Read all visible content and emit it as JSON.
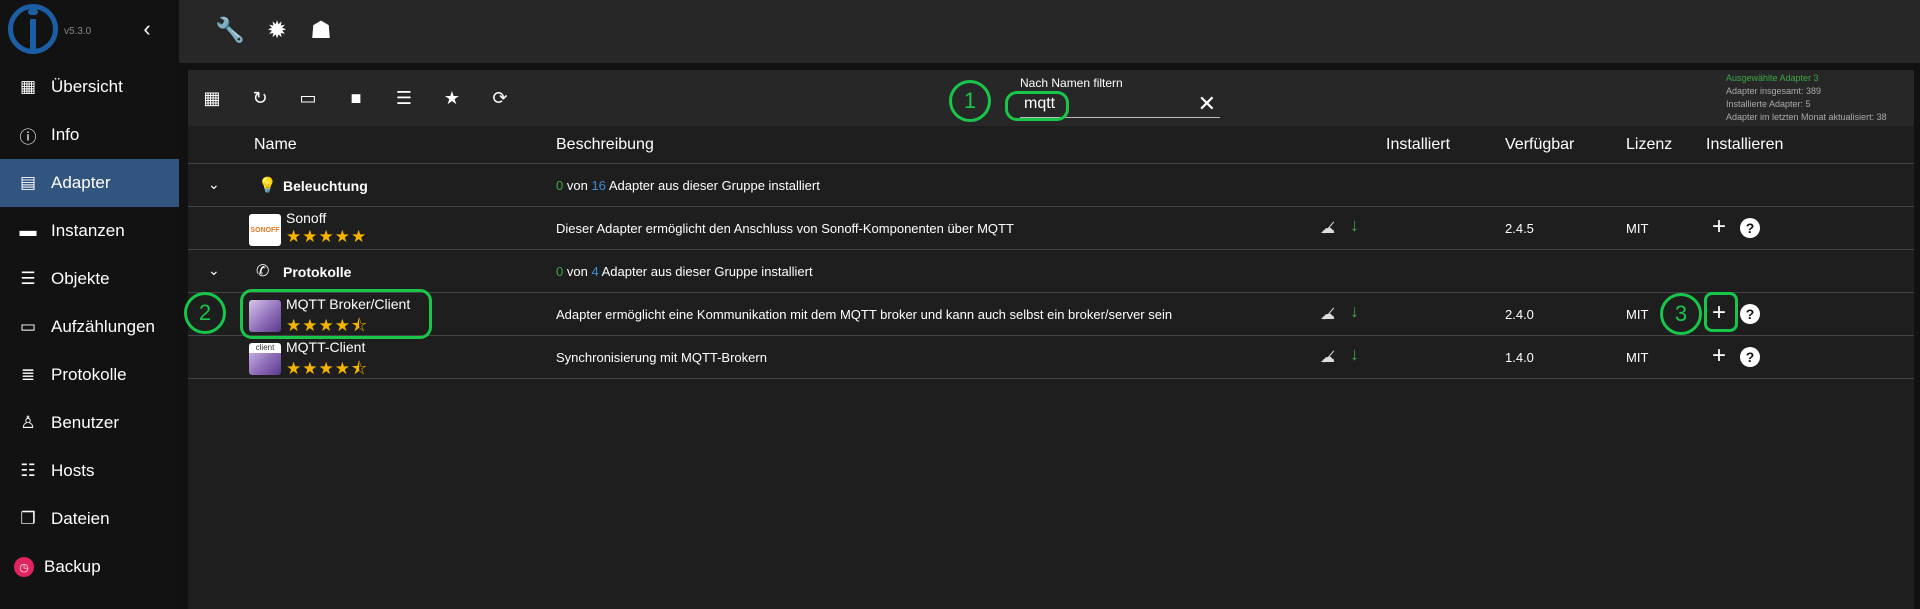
{
  "app": {
    "version": "v5.3.0"
  },
  "sidebar": {
    "collapse_label": "‹",
    "items": [
      {
        "label": "Übersicht",
        "icon": "grid-icon"
      },
      {
        "label": "Info",
        "icon": "info-icon"
      },
      {
        "label": "Adapter",
        "icon": "store-icon",
        "active": true
      },
      {
        "label": "Instanzen",
        "icon": "instances-icon"
      },
      {
        "label": "Objekte",
        "icon": "list-icon"
      },
      {
        "label": "Aufzählungen",
        "icon": "enum-icon"
      },
      {
        "label": "Protokolle",
        "icon": "log-icon"
      },
      {
        "label": "Benutzer",
        "icon": "user-icon"
      },
      {
        "label": "Hosts",
        "icon": "hosts-icon"
      },
      {
        "label": "Dateien",
        "icon": "files-icon"
      },
      {
        "label": "Backup",
        "icon": "backup-icon"
      }
    ]
  },
  "filter": {
    "label": "Nach Namen filtern",
    "value": "mqtt"
  },
  "stats": {
    "selected": "Ausgewählte Adapter 3",
    "total": "Adapter insgesamt: 389",
    "installed": "Installierte Adapter: 5",
    "updated": "Adapter im letzten Monat aktualisiert: 38"
  },
  "table": {
    "headers": {
      "name": "Name",
      "description": "Beschreibung",
      "installed": "Installiert",
      "available": "Verfügbar",
      "license": "Lizenz",
      "install": "Installieren"
    },
    "groups": [
      {
        "title": "Beleuchtung",
        "count_installed": "0",
        "count_total": "16",
        "text_von": "von",
        "text_suffix": "Adapter aus dieser Gruppe installiert"
      },
      {
        "title": "Protokolle",
        "count_installed": "0",
        "count_total": "4",
        "text_von": "von",
        "text_suffix": "Adapter aus dieser Gruppe installiert"
      }
    ],
    "adapters": [
      {
        "name": "Sonoff",
        "icon_text": "SONOFF",
        "rating": 5,
        "stars": "★★★★★",
        "description": "Dieser Adapter ermöglicht den Anschluss von Sonoff-Komponenten über MQTT",
        "available": "2.4.5",
        "license": "MIT"
      },
      {
        "name": "MQTT Broker/Client",
        "rating": 4.5,
        "stars": "★★★★⯪",
        "description": "Adapter ermöglicht eine Kommunikation mit dem MQTT broker und kann auch selbst ein broker/server sein",
        "available": "2.4.0",
        "license": "MIT"
      },
      {
        "name": "MQTT-Client",
        "icon_text": "client",
        "rating": 4.5,
        "stars": "★★★★⯪",
        "description": "Synchronisierung mit MQTT-Brokern",
        "available": "1.4.0",
        "license": "MIT"
      }
    ]
  },
  "annotations": [
    "1",
    "2",
    "3"
  ],
  "colors": {
    "accent": "#31557e",
    "green": "#3aa845",
    "annotation": "#18c64a",
    "star": "#f4b400"
  }
}
